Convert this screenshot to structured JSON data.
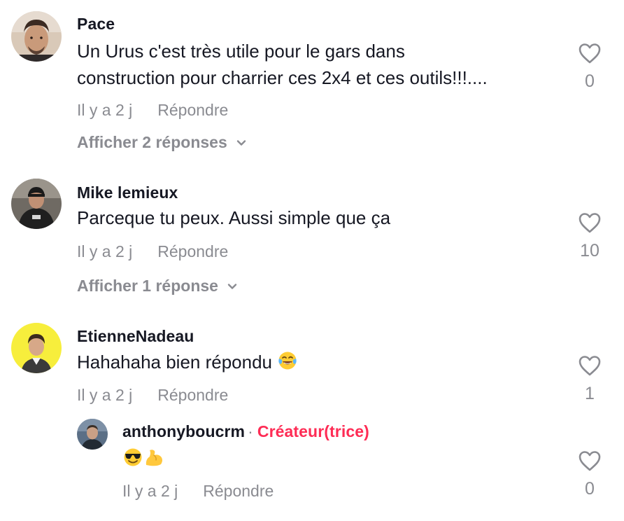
{
  "comments": [
    {
      "username": "Pace",
      "text_lines": [
        "Un Urus c'est très utile pour le gars dans",
        "construction pour charrier ces 2x4 et ces outils!!!...."
      ],
      "time": "Il y a 2 j",
      "reply_label": "Répondre",
      "likes": "0",
      "view_replies": "Afficher 2 réponses"
    },
    {
      "username": "Mike lemieux",
      "text_lines": [
        "Parceque tu peux. Aussi simple que ça"
      ],
      "time": "Il y a 2 j",
      "reply_label": "Répondre",
      "likes": "10",
      "view_replies": "Afficher 1 réponse"
    },
    {
      "username": "EtienneNadeau",
      "text_lines": [
        "Hahahaha bien répondu"
      ],
      "time": "Il y a 2 j",
      "reply_label": "Répondre",
      "likes": "1"
    }
  ],
  "reply": {
    "username": "anthonyboucrm",
    "separator": "·",
    "creator_label": "Créateur(trice)",
    "time": "Il y a 2 j",
    "reply_label": "Répondre",
    "likes": "0"
  },
  "icons": {
    "like": "heart-outline-icon",
    "expand": "chevron-down-icon",
    "laughing": "face-with-tears-of-joy-emoji",
    "cool": "smiling-face-with-sunglasses-emoji",
    "flex": "flexed-biceps-emoji"
  },
  "colors": {
    "text_primary": "#161823",
    "text_secondary": "#8a8b91",
    "creator_accent": "#fe2c55",
    "avatar_yellow": "#f7ee3c"
  }
}
